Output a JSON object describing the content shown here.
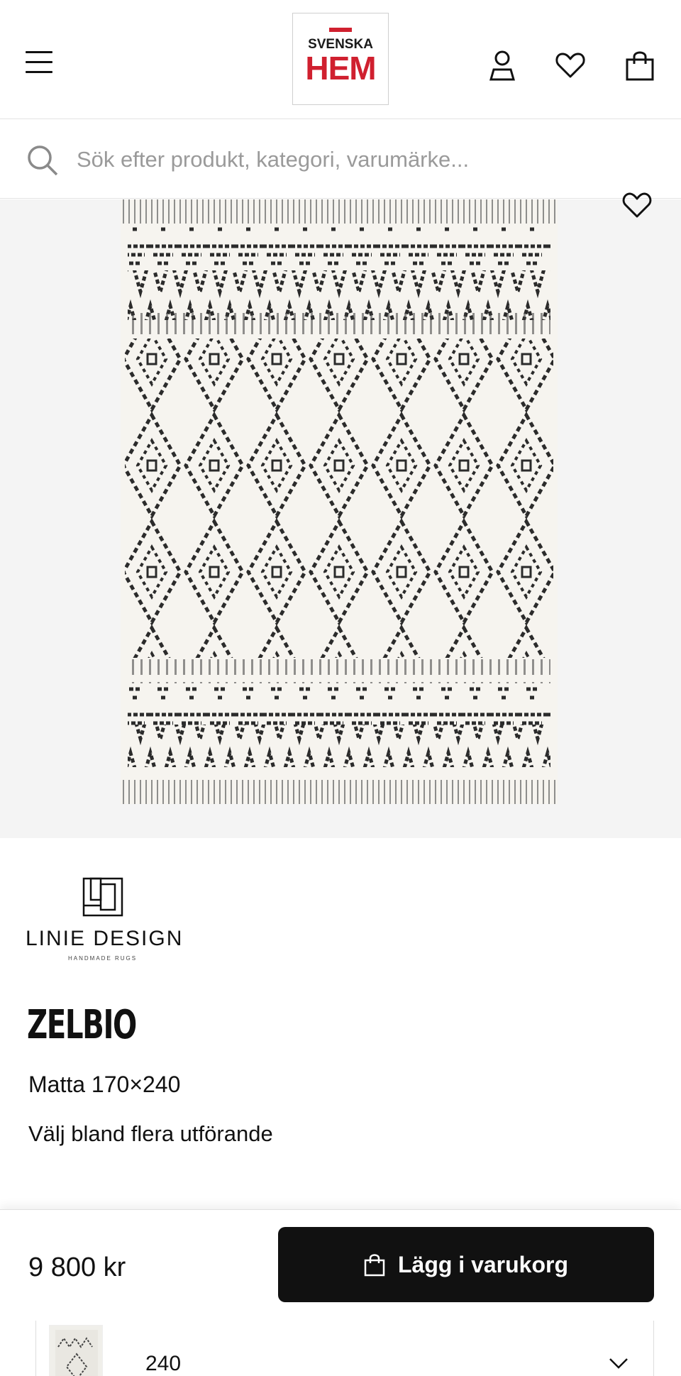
{
  "header": {
    "logo_top": "SVENSKA",
    "logo_bottom": "HEM",
    "brand_color": "#d0202f",
    "icons": [
      "menu-icon",
      "user-icon",
      "heart-icon",
      "bag-icon"
    ]
  },
  "search": {
    "placeholder": "Sök efter produkt, kategori, varumärke..."
  },
  "product": {
    "brand_name": "LINIE DESIGN",
    "brand_tagline": "HANDMADE RUGS",
    "title": "ZELBIO",
    "subtitle": "Matta 170×240",
    "variants_text": "Välj bland flera utförande",
    "price": "9 800 kr",
    "add_to_cart_label": "Lägg i varukorg",
    "selected_variant": "240"
  }
}
